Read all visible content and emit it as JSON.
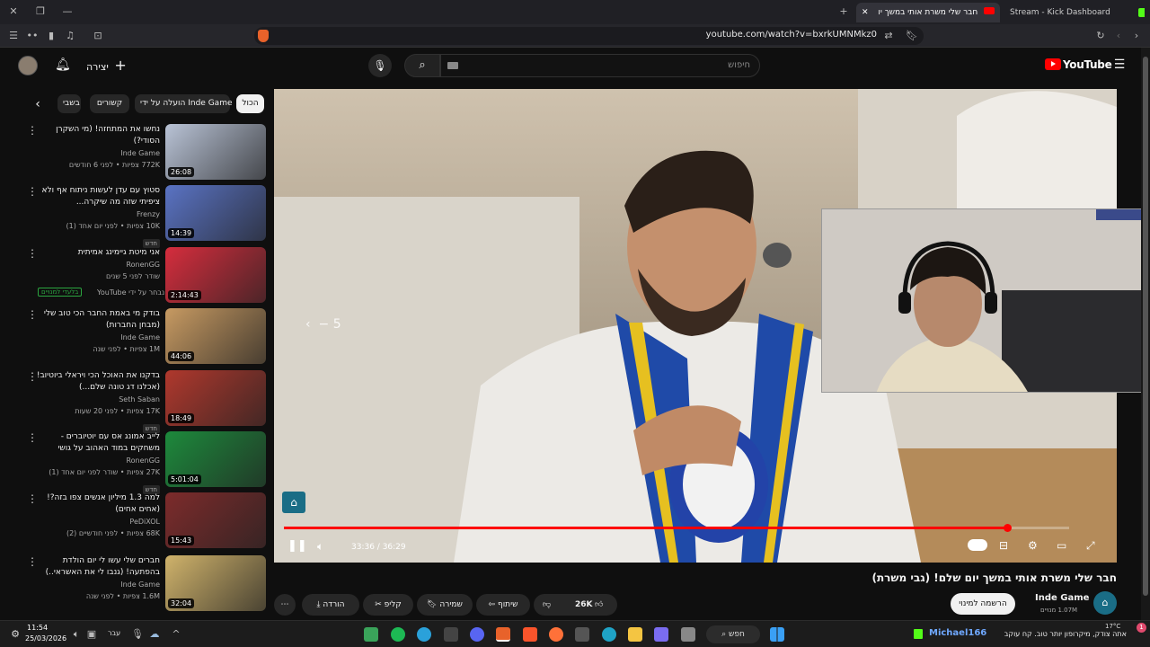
{
  "browser": {
    "tabs": [
      {
        "label": "חבר שלי משרת אותי במשך יו"
      },
      {
        "label": "Stream - Kick Dashboard"
      }
    ],
    "url": "youtube.com/watch?v=bxrkUMNMkz0"
  },
  "youtube": {
    "logo_text": "YouTube",
    "search_placeholder": "חיפוש",
    "create_label": "יצירה"
  },
  "chips": [
    "הכול",
    "הועלה על ידי Inde Game",
    "קשורים",
    "בשבי"
  ],
  "sidebar_items": [
    {
      "title": "נחשו את המתחזה! (מי השקרן הסודי?)",
      "channel": "Inde Game",
      "meta": "772K צפיות • לפני 6 חודשים",
      "duration": "26:08",
      "badge": "",
      "thumb": "#b9c3d6"
    },
    {
      "title": "סטוץ עם עדן לעשות ניתוח אף ולא ציפיתי שזה מה שיקרה...",
      "channel": "Frenzy",
      "meta": "10K צפיות • לפני יום אחד (1)",
      "duration": "14:39",
      "badge": "חדש",
      "thumb": "#5a73c4"
    },
    {
      "title": "אני מיטת גיימינג אמיתית",
      "channel": "RonenGG",
      "meta": "שודר לפני 5 שנים",
      "duration": "2:14:43",
      "badge": "",
      "thumb": "#d62d3d"
    },
    {
      "title": "בודק מי באמת החבר הכי טוב שלי (מבחן החברות)",
      "channel": "Inde Game",
      "meta": "1M צפיות • לפני שנה",
      "duration": "44:06",
      "badge": "",
      "thumb": "#c79a62"
    },
    {
      "title": "בדקנו את האוכל הכי ויראלי ביוטיוב! (אכלנו דג טונה שלם...)",
      "channel": "Seth Saban",
      "meta": "17K צפיות • לפני 20 שעות",
      "duration": "18:49",
      "badge": "חדש",
      "thumb": "#b0382d"
    },
    {
      "title": "לייב אמונג אס עם יוטיוברים - משחקים במוד האהוב על גושי",
      "channel": "RonenGG",
      "meta": "27K צפיות • שודר לפני יום אחד (1)",
      "duration": "5:01:04",
      "badge": "חדש",
      "thumb": "#1d8a3c"
    },
    {
      "title": "למה 1.3 מיליון אנשים צפו בזה?! (אחים אחים)",
      "channel": "PeDiXOL",
      "meta": "68K צפיות • לפני חודשיים (2)",
      "duration": "15:43",
      "badge": "",
      "thumb": "#7d2b2b"
    },
    {
      "title": "חברים שלי עשו לי יום הולדת בהפתעה! (גנבו לי את האשראי..)",
      "channel": "Inde Game",
      "meta": "1.6M צפיות • לפני שנה",
      "duration": "32:04",
      "badge": "",
      "thumb": "#d0b36b"
    }
  ],
  "sidebar_extra": {
    "youtube_rec": "נבחר על ידי YouTube",
    "members": "בלעדי למנויים"
  },
  "player": {
    "time": "33:36 / 36:29",
    "progress": 0.9215,
    "seek_hint": "5"
  },
  "video": {
    "title": "חבר שלי משרת אותי במשך יום שלם! (גבי משרת)",
    "channel": "Inde Game",
    "subscribers": "1.07M מנויים",
    "subscribe_label": "הרשמה למינוי",
    "likes": "26K",
    "share_label": "שיתוף",
    "save_label": "שמירה",
    "clip_label": "קליפ",
    "download_label": "הורדה"
  },
  "taskbar": {
    "time": "11:54",
    "date": "25/03/2026",
    "lang": "עבר",
    "search_label": "חפש",
    "kick_user": "Michael166",
    "ticker": "אתה צודק, מיקרופון יותר טוב. קח עוקב",
    "weather": "17°C",
    "notif_count": "1"
  }
}
